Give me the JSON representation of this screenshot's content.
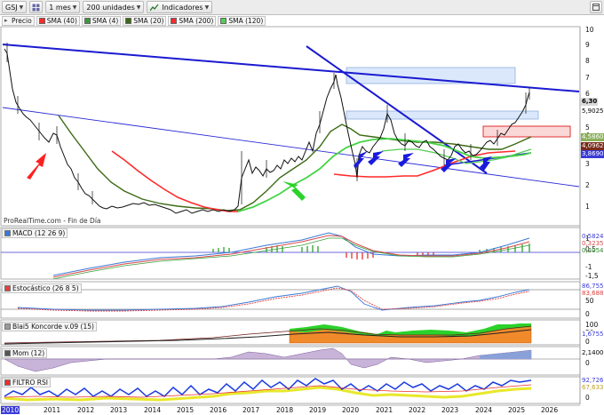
{
  "toolbar": {
    "symbol": "GSJ",
    "period": "1 mes",
    "units": "200 unidades",
    "indicators": "Indicadores"
  },
  "legend": {
    "price": "Precio",
    "sma40": "SMA (40)",
    "sma4": "SMA (4)",
    "sma20": "SMA (20)",
    "sma200": "SMA (200)",
    "sma120": "SMA (120)"
  },
  "watermark": "ProRealTime.com - Fin de Día",
  "price_axis": {
    "ticks": [
      "10",
      "9",
      "8",
      "7",
      "6",
      "5",
      "4",
      "3",
      "2",
      "1"
    ],
    "tags": {
      "last": "6,30",
      "t1": "5,9025",
      "t2": "4,5860",
      "t3": "4,0962",
      "t4": "3,8690"
    }
  },
  "macd": {
    "label": "MACD (12 26 9)",
    "ticks": [
      "1",
      "0,5",
      "-1",
      "-1,5"
    ],
    "tags": {
      "t1": "0,5824",
      "t2": "0,3235",
      "t3": "0,2054"
    }
  },
  "stoch": {
    "label": "Estocástico (26 8 5)",
    "ticks": [
      "50",
      "0"
    ],
    "tags": {
      "t1": "86,7559",
      "t2": "83,688"
    }
  },
  "blai5": {
    "label": "Blai5 Koncorde v.09 (15)",
    "ticks": [
      "100",
      "50",
      "0"
    ],
    "tags": {
      "t1": "1,6755"
    }
  },
  "mom": {
    "label": "Mom (12)",
    "ticks": [
      "0"
    ],
    "tags": {
      "t1": "2,1400"
    }
  },
  "rsi": {
    "label": "FILTRO RSI",
    "ticks": [
      "0"
    ],
    "tags": {
      "t1": "92,726",
      "t2": "67,633"
    }
  },
  "x_axis": [
    "2010",
    "2011",
    "2012",
    "2013",
    "2014",
    "2015",
    "2016",
    "2017",
    "2018",
    "2019",
    "2020",
    "2021",
    "2022",
    "2023",
    "2024",
    "2025",
    "2026"
  ],
  "colors": {
    "price": "#111111",
    "sma40": "#2f7d1a",
    "sma4": "#ff3030",
    "sma20": "#5b6a1a",
    "sma200": "#1e9e2a",
    "sma120": "#55cc55",
    "trend": "#1a1acc",
    "accent_red": "#e83030",
    "accent_green": "#2ad22a"
  },
  "chart_data": {
    "type": "line",
    "x": [
      "2010",
      "2011",
      "2012",
      "2013",
      "2014",
      "2015",
      "2016",
      "2017",
      "2018",
      "2019",
      "2020",
      "2021",
      "2022",
      "2023",
      "2024",
      "2025"
    ],
    "series": [
      {
        "name": "Precio",
        "values": [
          8.6,
          5.0,
          2.2,
          1.3,
          1.35,
          1.2,
          1.3,
          2.8,
          3.0,
          7.4,
          3.2,
          5.2,
          3.8,
          3.1,
          3.6,
          6.3
        ]
      }
    ],
    "ylim": [
      1,
      10
    ],
    "log_scale": true
  }
}
